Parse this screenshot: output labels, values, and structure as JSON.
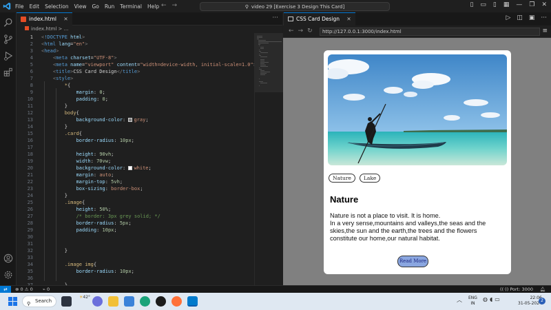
{
  "titlebar": {
    "menu": [
      "File",
      "Edit",
      "Selection",
      "View",
      "Go",
      "Run",
      "Terminal",
      "Help"
    ],
    "search_text": "video 29 [Exercise 3 Design This Card]"
  },
  "editor": {
    "tab_label": "index.html",
    "breadcrumb": "index.html > ...",
    "lines": [
      {
        "n": "1",
        "html": "<span class='t-punct'>&lt;</span><span class='t-tag'>!DOCTYPE</span> <span class='t-attr'>html</span><span class='t-punct'>&gt;</span>"
      },
      {
        "n": "2",
        "html": "<span class='t-punct'>&lt;</span><span class='t-tag'>html</span> <span class='t-attr'>lang</span><span class='t-text'>=</span><span class='t-str'>\"en\"</span><span class='t-punct'>&gt;</span>"
      },
      {
        "n": "3",
        "html": "<span class='t-punct'>&lt;</span><span class='t-tag'>head</span><span class='t-punct'>&gt;</span>"
      },
      {
        "n": "4",
        "html": "    <span class='t-punct'>&lt;</span><span class='t-tag'>meta</span> <span class='t-attr'>charset</span><span class='t-text'>=</span><span class='t-str'>\"UTF-8\"</span><span class='t-punct'>&gt;</span>"
      },
      {
        "n": "5",
        "html": "    <span class='t-punct'>&lt;</span><span class='t-tag'>meta</span> <span class='t-attr'>name</span><span class='t-text'>=</span><span class='t-str'>\"viewport\"</span> <span class='t-attr'>content</span><span class='t-text'>=</span><span class='t-str'>\"width=device-width, initial-scale=1.0\"</span><span class='t-punct'>&gt;</span>"
      },
      {
        "n": "6",
        "html": "    <span class='t-punct'>&lt;</span><span class='t-tag'>title</span><span class='t-punct'>&gt;</span><span class='t-text'>CSS Card Design</span><span class='t-punct'>&lt;/</span><span class='t-tag'>title</span><span class='t-punct'>&gt;</span>"
      },
      {
        "n": "7",
        "html": "    <span class='t-punct'>&lt;</span><span class='t-tag'>style</span><span class='t-punct'>&gt;</span>"
      },
      {
        "n": "8",
        "html": "        <span class='t-sel'>*</span><span class='t-text'>{</span>"
      },
      {
        "n": "9",
        "html": "            <span class='t-prop'>margin</span><span class='t-text'>: </span><span class='t-num'>0</span><span class='t-text'>;</span>"
      },
      {
        "n": "10",
        "html": "            <span class='t-prop'>padding</span><span class='t-text'>: </span><span class='t-num'>0</span><span class='t-text'>;</span>"
      },
      {
        "n": "11",
        "html": "        <span class='t-text'>}</span>"
      },
      {
        "n": "12",
        "html": "        <span class='t-sel'>body</span><span class='t-text'>{</span>"
      },
      {
        "n": "13",
        "html": "            <span class='t-prop'>background-color</span><span class='t-text'>: </span><span class='swatch' style='background:#808080'></span><span class='t-val'>gray</span><span class='t-text'>;</span>"
      },
      {
        "n": "14",
        "html": "        <span class='t-text'>}</span>"
      },
      {
        "n": "15",
        "html": "        <span class='t-sel'>.card</span><span class='t-text'>{</span>"
      },
      {
        "n": "16",
        "html": "            <span class='t-prop'>border-radius</span><span class='t-text'>: </span><span class='t-num'>10px</span><span class='t-text'>;</span>"
      },
      {
        "n": "17",
        "html": ""
      },
      {
        "n": "18",
        "html": "            <span class='t-prop'>height</span><span class='t-text'>: </span><span class='t-num'>90vh</span><span class='t-text'>;</span>"
      },
      {
        "n": "19",
        "html": "            <span class='t-prop'>width</span><span class='t-text'>: </span><span class='t-num'>70vw</span><span class='t-text'>;</span>"
      },
      {
        "n": "20",
        "html": "            <span class='t-prop'>background-color</span><span class='t-text'>: </span><span class='swatch' style='background:#ffffff'></span><span class='t-val'>white</span><span class='t-text'>;</span>"
      },
      {
        "n": "21",
        "html": "            <span class='t-prop'>margin</span><span class='t-text'>: </span><span class='t-val'>auto</span><span class='t-text'>;</span>"
      },
      {
        "n": "22",
        "html": "            <span class='t-prop'>margin-top</span><span class='t-text'>: </span><span class='t-num'>5vh</span><span class='t-text'>;</span>"
      },
      {
        "n": "23",
        "html": "            <span class='t-prop'>box-sizing</span><span class='t-text'>: </span><span class='t-val'>border-box</span><span class='t-text'>;</span>"
      },
      {
        "n": "24",
        "html": "        <span class='t-text'>}</span>"
      },
      {
        "n": "25",
        "html": "        <span class='t-sel'>.image</span><span class='t-text'>{</span>"
      },
      {
        "n": "26",
        "html": "            <span class='t-prop'>height</span><span class='t-text'>: </span><span class='t-num'>50%</span><span class='t-text'>;</span>"
      },
      {
        "n": "27",
        "html": "            <span class='t-com'>/* border: 3px grey solid; */</span>"
      },
      {
        "n": "28",
        "html": "            <span class='t-prop'>border-radius</span><span class='t-text'>: </span><span class='t-num'>5px</span><span class='t-text'>;</span>"
      },
      {
        "n": "29",
        "html": "            <span class='t-prop'>padding</span><span class='t-text'>: </span><span class='t-num'>10px</span><span class='t-text'>;</span>"
      },
      {
        "n": "30",
        "html": ""
      },
      {
        "n": "31",
        "html": ""
      },
      {
        "n": "32",
        "html": "        <span class='t-text'>}</span>"
      },
      {
        "n": "33",
        "html": ""
      },
      {
        "n": "34",
        "html": "        <span class='t-sel'>.image img</span><span class='t-text'>{</span>"
      },
      {
        "n": "35",
        "html": "            <span class='t-prop'>border-radius</span><span class='t-text'>: </span><span class='t-num'>10px</span><span class='t-text'>;</span>"
      },
      {
        "n": "36",
        "html": ""
      },
      {
        "n": "37",
        "html": "        <span class='t-text'>}</span>"
      }
    ]
  },
  "browser": {
    "tab_label": "CSS Card Design",
    "url": "http://127.0.0.1:3000/index.html"
  },
  "card": {
    "tags": [
      "Nature",
      "Lake"
    ],
    "title": "Nature",
    "text": "Nature is not a place to visit. It is home.\nIn a very sense,mountains and valleys,the seas and the skies,the sun and the earth,the trees and the flowers constitute our home,our natural habitat.",
    "button_label": "Read More"
  },
  "statusbar": {
    "problems": "⊗ 0 ⚠ 0",
    "ports_count": "0",
    "port_label": "Port: 3000"
  },
  "taskbar": {
    "search_label": "Search",
    "temperature": "42°",
    "lang_top": "ENG",
    "lang_bottom": "IN",
    "time": "22:06",
    "date": "31-05-2024",
    "notifications": "2"
  },
  "colors": {
    "accent": "#0078d4",
    "editor_bg": "#1f1f1f",
    "browser_bg": "#808080",
    "button_bg": "#8aa6e0"
  }
}
